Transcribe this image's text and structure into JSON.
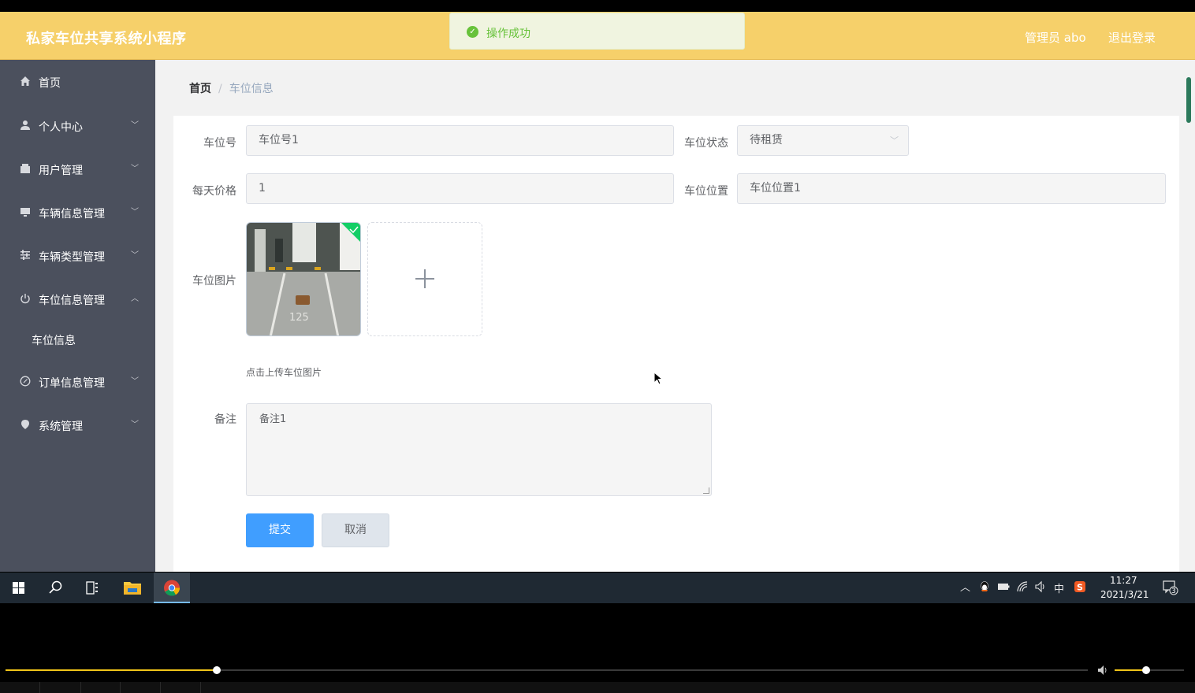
{
  "header": {
    "title": "私家车位共享系统小程序",
    "admin": "管理员 abo",
    "logout": "退出登录"
  },
  "toast": {
    "message": "操作成功"
  },
  "sidebar": {
    "items": [
      {
        "label": "首页",
        "icon": "home-icon"
      },
      {
        "label": "个人中心",
        "icon": "user-icon"
      },
      {
        "label": "用户管理",
        "icon": "wallet-icon"
      },
      {
        "label": "车辆信息管理",
        "icon": "monitor-icon"
      },
      {
        "label": "车辆类型管理",
        "icon": "sliders-icon"
      },
      {
        "label": "车位信息管理",
        "icon": "power-icon"
      },
      {
        "label": "车位信息",
        "icon": ""
      },
      {
        "label": "订单信息管理",
        "icon": "compass-icon"
      },
      {
        "label": "系统管理",
        "icon": "location-icon"
      }
    ]
  },
  "breadcrumb": {
    "home": "首页",
    "separator": "/",
    "current": "车位信息"
  },
  "form": {
    "spot_no": {
      "label": "车位号",
      "value": "车位号1"
    },
    "status": {
      "label": "车位状态",
      "value": "待租赁"
    },
    "price": {
      "label": "每天价格",
      "value": "1"
    },
    "location": {
      "label": "车位位置",
      "value": "车位位置1"
    },
    "image": {
      "label": "车位图片",
      "tip": "点击上传车位图片"
    },
    "remark": {
      "label": "备注",
      "value": "备注1"
    },
    "submit": "提交",
    "cancel": "取消"
  },
  "taskbar": {
    "ime": "中",
    "time": "11:27",
    "date": "2021/3/21",
    "notifications": "3"
  },
  "player": {
    "progress": 0.195,
    "volume": 0.45
  },
  "colors": {
    "header": "#f6d06a",
    "sidebar": "#4b505d",
    "primary": "#409eff",
    "success": "#67c23a"
  }
}
